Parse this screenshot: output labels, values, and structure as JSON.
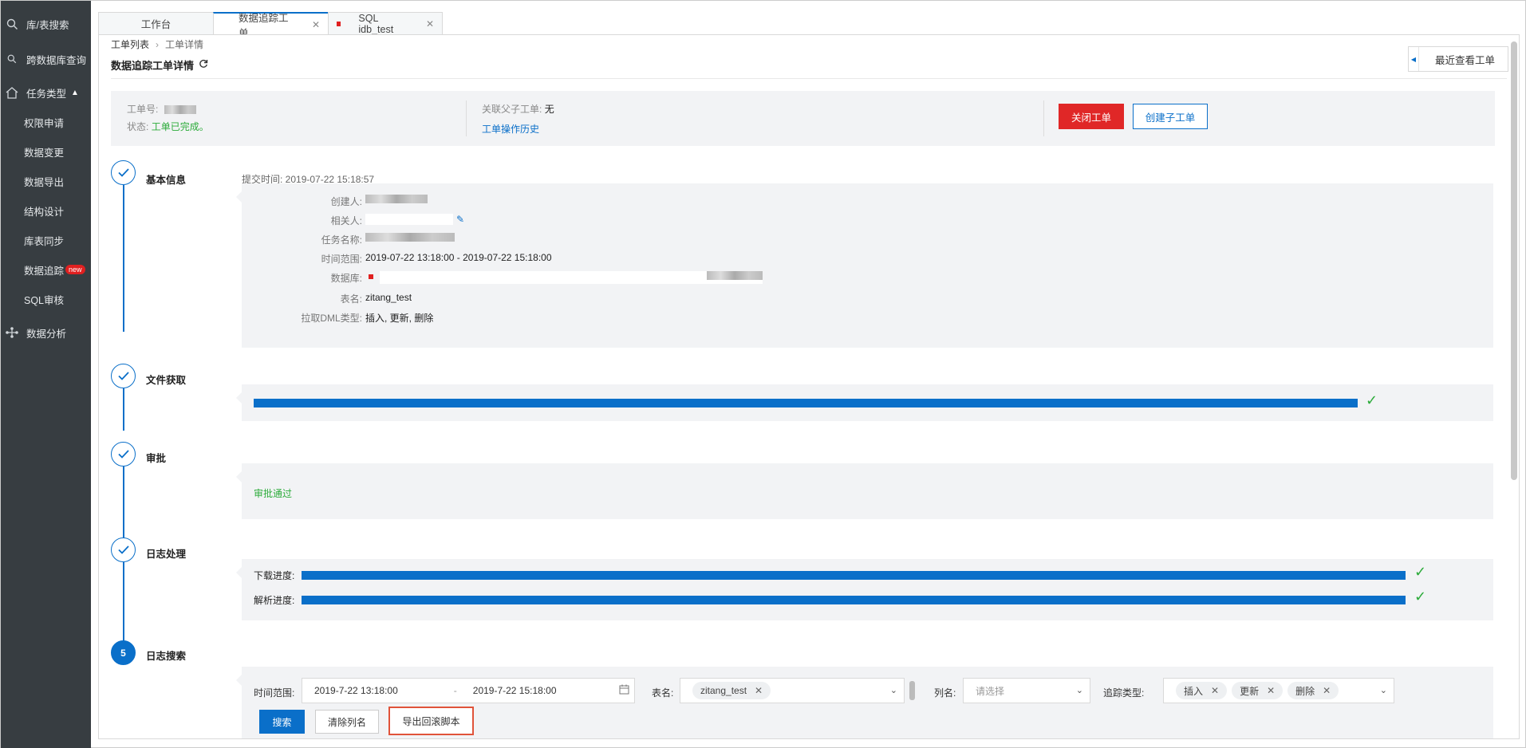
{
  "sidebar": {
    "items": [
      {
        "label": "库/表搜索",
        "icon": "search-icon"
      },
      {
        "label": "跨数据库查询",
        "icon": "search-icon"
      },
      {
        "label": "任务类型",
        "icon": "home-icon"
      },
      {
        "label": "权限申请"
      },
      {
        "label": "数据变更"
      },
      {
        "label": "数据导出"
      },
      {
        "label": "结构设计"
      },
      {
        "label": "库表同步"
      },
      {
        "label": "数据追踪",
        "badge": "new"
      },
      {
        "label": "SQL审核"
      },
      {
        "label": "数据分析",
        "icon": "flow-icon"
      }
    ]
  },
  "tabs": [
    {
      "label": "工作台"
    },
    {
      "label": "数据追踪工单"
    },
    {
      "label": "SQL idb_test"
    }
  ],
  "breadcrumb": {
    "root": "工单列表",
    "current": "工单详情"
  },
  "page_title": "数据追踪工单详情",
  "recent_button": "最近查看工单",
  "info": {
    "order_no_label": "工单号:",
    "status_label": "状态:",
    "status_value": "工单已完成。",
    "parent_label": "关联父子工单:",
    "parent_value": "无",
    "history_link": "工单操作历史",
    "close_button": "关闭工单",
    "create_child_button": "创建子工单"
  },
  "steps": {
    "basic": {
      "title": "基本信息",
      "submit_time": "提交时间: 2019-07-22 15:18:57",
      "fields": {
        "creator_label": "创建人:",
        "related_label": "相关人:",
        "task_label": "任务名称:",
        "range_label": "时间范围:",
        "range_value": "2019-07-22 13:18:00 - 2019-07-22 15:18:00",
        "db_label": "数据库:",
        "table_label": "表名:",
        "table_value": "zitang_test",
        "dml_label": "拉取DML类型:",
        "dml_value": "插入, 更新, 删除"
      }
    },
    "file": {
      "title": "文件获取",
      "progress": 1.0
    },
    "approve": {
      "title": "审批",
      "result": "审批通过"
    },
    "log": {
      "title": "日志处理",
      "download_label": "下载进度:",
      "download_progress": 1.0,
      "parse_label": "解析进度:",
      "parse_progress": 1.0
    },
    "search": {
      "number": "5",
      "title": "日志搜索",
      "time_label": "时间范围:",
      "start": "2019-7-22 13:18:00",
      "dash": "-",
      "end": "2019-7-22 15:18:00",
      "table_label": "表名:",
      "table_tag": "zitang_test",
      "column_label": "列名:",
      "column_placeholder": "请选择",
      "track_label": "追踪类型:",
      "track_tags": [
        "插入",
        "更新",
        "删除"
      ],
      "search_button": "搜索",
      "clear_button": "清除列名",
      "export_button": "导出回滚脚本"
    }
  },
  "colors": {
    "accent": "#0a6fc9",
    "danger": "#e02727",
    "success": "#2cab3a",
    "highlight": "#e0533a"
  }
}
